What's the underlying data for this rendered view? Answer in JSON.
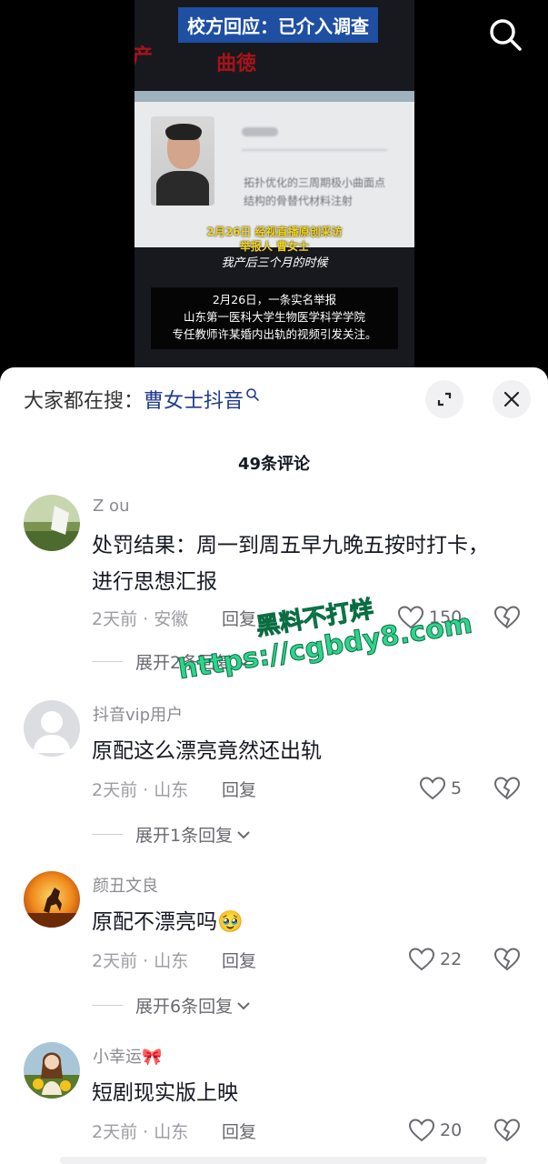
{
  "video": {
    "headline": "校方回应：已介入调查",
    "overlay_red_text": "产",
    "overlay_red_text_2": "曲徳",
    "doc_text_1": "拓扑优化的三周期极小曲面点",
    "doc_text_2": "结构的骨替代材料注射",
    "caption_yellow_1": "2月26日 经视直播原创采访",
    "caption_yellow_2": "举报人 曹女士",
    "caption_white": "我产后三个月的时候",
    "subtitle_lines": [
      "2月26日，一条实名举报",
      "山东第一医科大学生物医学科学学院",
      "专任教师许某婚内出轨的视频引发关注。"
    ],
    "search_icon": "search-icon"
  },
  "panel": {
    "suggest_label": "大家都在搜：",
    "suggest_term": "曹女士抖音",
    "expand_icon": "expand-icon",
    "close_icon": "close-icon",
    "comment_count": "49条评论"
  },
  "comments": [
    {
      "username": "Z ou",
      "text": "处罚结果：周一到周五早九晚五按时打卡，进行思想汇报",
      "meta": "2天前 · 安徽",
      "reply": "回复",
      "likes": "150",
      "expand": "展开2条回复"
    },
    {
      "username": "抖音vip用户",
      "text": "原配这么漂亮竟然还出轨",
      "meta": "2天前 · 山东",
      "reply": "回复",
      "likes": "5",
      "expand": "展开1条回复"
    },
    {
      "username": "颜丑文良",
      "text": "原配不漂亮吗🥹",
      "meta": "2天前 · 山东",
      "reply": "回复",
      "likes": "22",
      "expand": "展开6条回复"
    },
    {
      "username": "小幸运🎀",
      "text": "短剧现实版上映",
      "meta": "2天前 · 山东",
      "reply": "回复",
      "likes": "20"
    }
  ],
  "watermark": {
    "line1": "黑料不打烊",
    "line2": "https://cgbdy8.com"
  },
  "colors": {
    "headline_bg": "#1e4fa3",
    "suggest_term": "#1f3a8c",
    "watermark": "#2fd48c",
    "caption_yellow": "#f2d51a"
  }
}
